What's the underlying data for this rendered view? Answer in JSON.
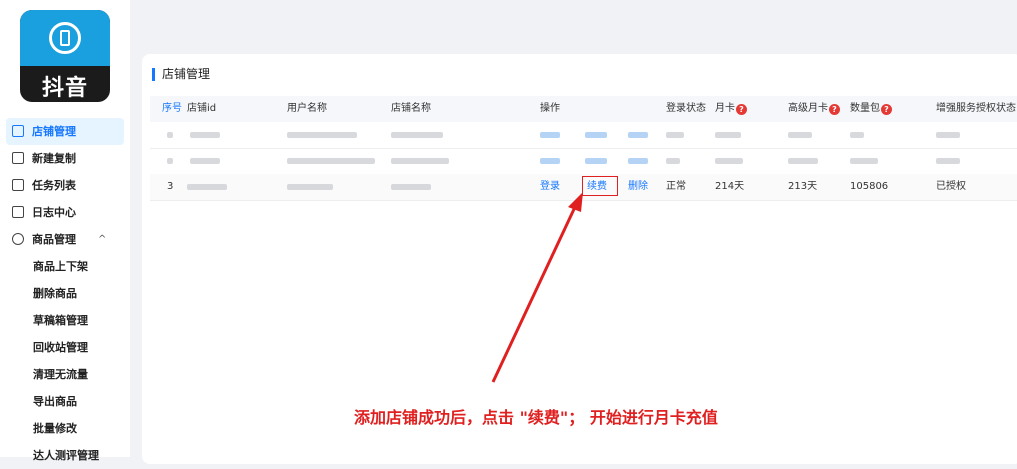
{
  "logo": {
    "text": "抖音"
  },
  "sidebar": {
    "items": [
      {
        "label": "店铺管理",
        "active": true
      },
      {
        "label": "新建复制"
      },
      {
        "label": "任务列表"
      },
      {
        "label": "日志中心"
      },
      {
        "label": "商品管理",
        "expanded": true,
        "chevron": "^"
      }
    ],
    "sub_items": [
      "商品上下架",
      "删除商品",
      "草稿箱管理",
      "回收站管理",
      "清理无流量",
      "导出商品",
      "批量修改",
      "达人测评管理"
    ]
  },
  "page": {
    "title": "店铺管理"
  },
  "table": {
    "columns": [
      "序号",
      "店铺id",
      "用户名称",
      "店铺名称",
      "操作",
      "登录状态",
      "月卡",
      "高级月卡",
      "数量包",
      "增强服务授权状态"
    ],
    "help_icon": "?",
    "row3": {
      "index": "3",
      "actions": [
        "登录",
        "续费",
        "删除"
      ],
      "login_status": "正常",
      "monthly_card": "214天",
      "premium_card": "213天",
      "quantity_pack": "105806",
      "auth_status": "已授权"
    }
  },
  "annotation": {
    "text": "添加店铺成功后，点击 \"续费\"； 开始进行月卡充值",
    "color": "#e02020"
  },
  "colors": {
    "accent": "#1677ff",
    "highlight": "#e02020"
  }
}
